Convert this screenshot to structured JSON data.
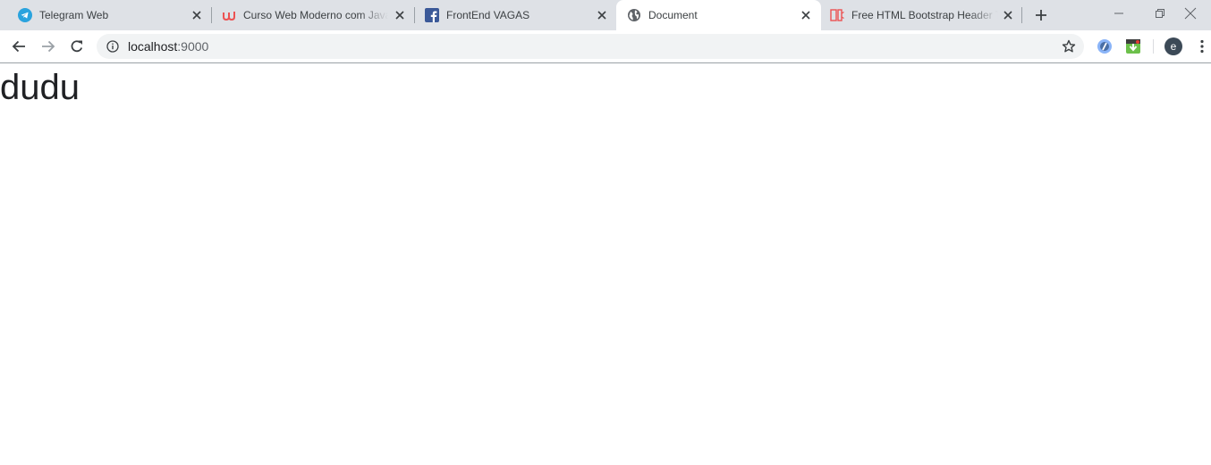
{
  "tabs": [
    {
      "title": "Telegram Web",
      "icon": "telegram-icon",
      "active": false
    },
    {
      "title": "Curso Web Moderno com JavaScript",
      "icon": "udemy-icon",
      "active": false
    },
    {
      "title": "FrontEnd VAGAS",
      "icon": "facebook-icon",
      "active": false
    },
    {
      "title": "Document",
      "icon": "globe-icon",
      "active": true
    },
    {
      "title": "Free HTML Bootstrap Header Templates",
      "icon": "template-icon",
      "active": false
    }
  ],
  "address_bar": {
    "host": "localhost",
    "port": ":9000"
  },
  "profile": {
    "initial": "e"
  },
  "page": {
    "heading": "dudu"
  },
  "colors": {
    "tabstrip_bg": "#dee1e6",
    "omnibox_bg": "#f1f3f4",
    "telegram": "#2aa3de",
    "udemy": "#ec5252",
    "facebook": "#3b5998",
    "avatar": "#3c4a57"
  }
}
